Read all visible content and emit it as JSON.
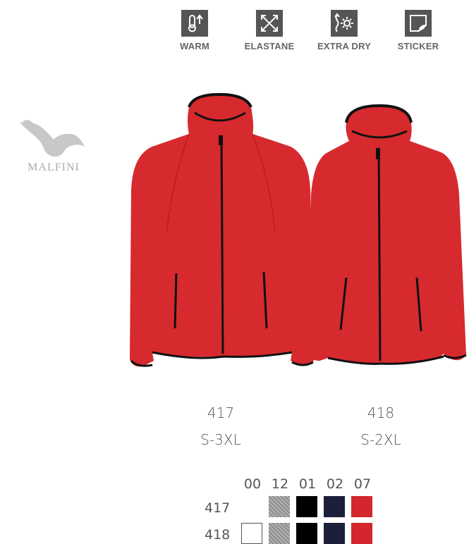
{
  "features": [
    {
      "icon": "thermometer-icon",
      "label": "WARM"
    },
    {
      "icon": "elastane-arrows-icon",
      "label": "ELASTANE"
    },
    {
      "icon": "sun-moisture-icon",
      "label": "EXTRA DRY"
    },
    {
      "icon": "sticker-icon",
      "label": "STICKER"
    }
  ],
  "brand": {
    "name": "MALFINI"
  },
  "products": [
    {
      "code": "417",
      "sizes": "S-3XL"
    },
    {
      "code": "418",
      "sizes": "S-2XL"
    }
  ],
  "colors": {
    "headers": [
      "00",
      "12",
      "01",
      "02",
      "07"
    ],
    "rows": [
      {
        "label": "417",
        "swatches": [
          null,
          "#9a9a9a",
          "#000000",
          "#1b1f3b",
          "#d3262d"
        ]
      },
      {
        "label": "418",
        "swatches": [
          "#ffffff",
          "#9a9a9a",
          "#000000",
          "#1b1f3b",
          "#d3262d"
        ]
      }
    ],
    "jacket_red": "#d62a2e"
  }
}
